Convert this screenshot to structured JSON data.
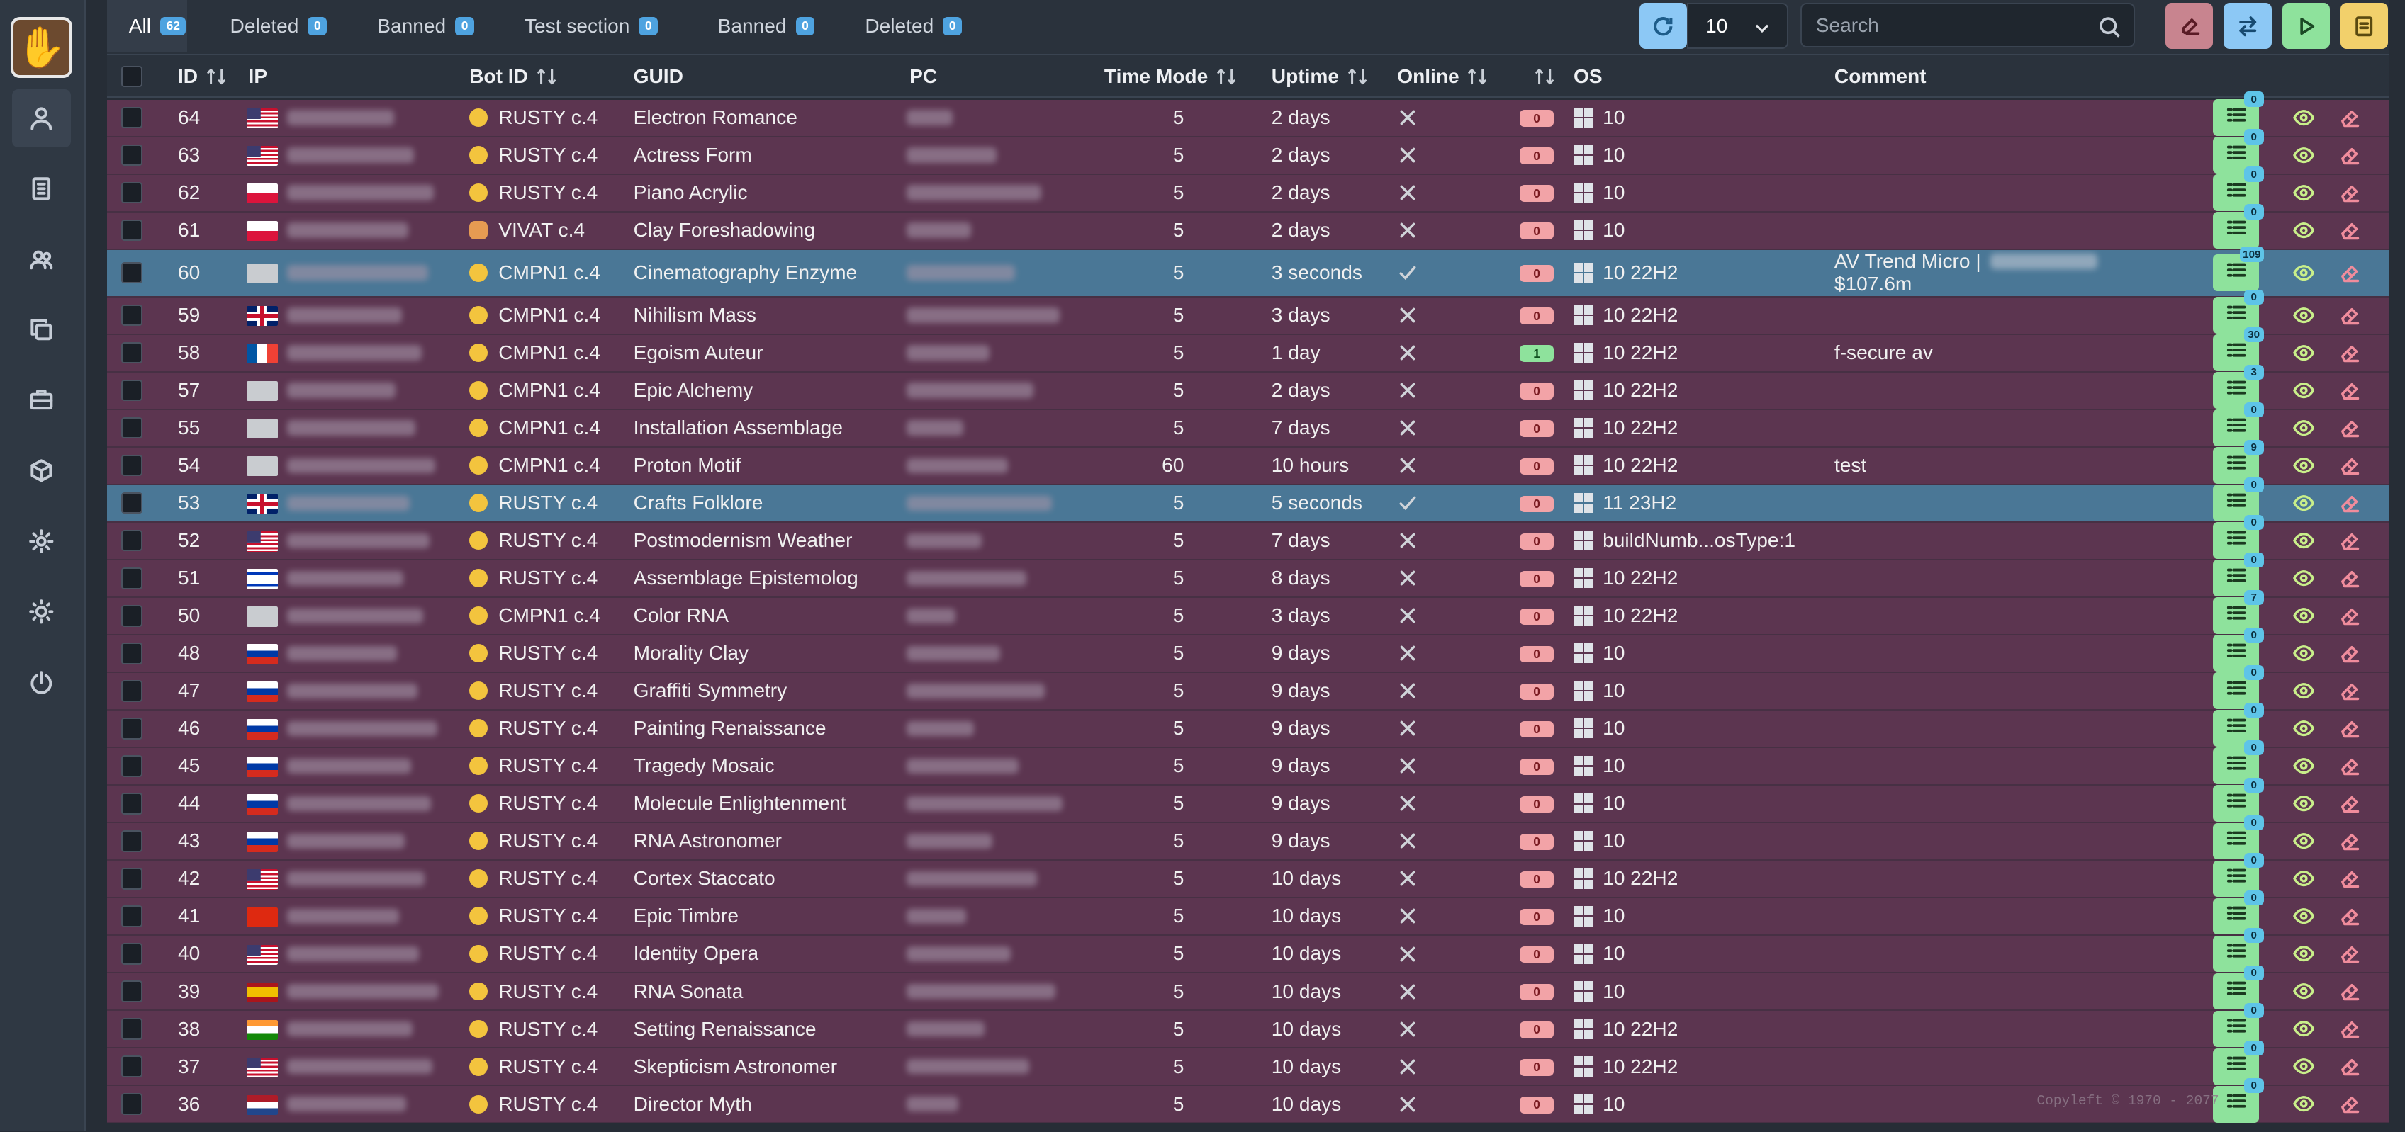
{
  "tabs": [
    {
      "label": "All",
      "count": "62"
    },
    {
      "label": "Deleted",
      "count": "0"
    },
    {
      "label": "Banned",
      "count": "0"
    },
    {
      "label": "Test section",
      "count": "0"
    },
    {
      "label": "Banned",
      "count": "0"
    },
    {
      "label": "Deleted",
      "count": "0"
    }
  ],
  "toolbar": {
    "page_size": "10",
    "search_placeholder": "Search"
  },
  "sidebar": {
    "icons": [
      "hand-logo",
      "user-icon",
      "document-icon",
      "users-icon",
      "copy-icon",
      "briefcase-icon",
      "cube-icon",
      "gear-icon",
      "sun-icon",
      "power-icon"
    ]
  },
  "columns": {
    "id": "ID",
    "ip": "IP",
    "bot_id": "Bot ID",
    "guid": "GUID",
    "pc": "PC",
    "time_mode": "Time Mode",
    "uptime": "Uptime",
    "online": "Online",
    "os": "OS",
    "comment": "Comment"
  },
  "colors": {
    "row": "#5c3550",
    "row_online": "#4a7796",
    "accent": "#4ea3e0",
    "success": "#8ee29c",
    "danger": "#f2a3a7"
  },
  "rows": [
    {
      "id": "64",
      "flag": "us",
      "bot": "RUSTY c.4",
      "guid": "Electron Romance",
      "tm": "5",
      "uptime": "2 days",
      "online": false,
      "cnt": "0",
      "os": "10",
      "comment": "",
      "notes": "0"
    },
    {
      "id": "63",
      "flag": "us",
      "bot": "RUSTY c.4",
      "guid": "Actress Form",
      "tm": "5",
      "uptime": "2 days",
      "online": false,
      "cnt": "0",
      "os": "10",
      "comment": "",
      "notes": "0"
    },
    {
      "id": "62",
      "flag": "pl",
      "bot": "RUSTY c.4",
      "guid": "Piano Acrylic",
      "tm": "5",
      "uptime": "2 days",
      "online": false,
      "cnt": "0",
      "os": "10",
      "comment": "",
      "notes": "0"
    },
    {
      "id": "61",
      "flag": "pl",
      "bot": "VIVAT c.4",
      "guid": "Clay Foreshadowing",
      "tm": "5",
      "uptime": "2 days",
      "online": false,
      "cnt": "0",
      "os": "10",
      "comment": "",
      "notes": "0"
    },
    {
      "id": "60",
      "flag": "xx",
      "bot": "CMPN1 c.4",
      "guid": "Cinematography Enzyme",
      "tm": "5",
      "uptime": "3 seconds",
      "online": true,
      "cnt": "0",
      "os": "10 22H2",
      "comment": "AV Trend Micro |",
      "comment2": "$107.6m",
      "notes": "109"
    },
    {
      "id": "59",
      "flag": "gb",
      "bot": "CMPN1 c.4",
      "guid": "Nihilism Mass",
      "tm": "5",
      "uptime": "3 days",
      "online": false,
      "cnt": "0",
      "os": "10 22H2",
      "comment": "",
      "notes": "0"
    },
    {
      "id": "58",
      "flag": "fr",
      "bot": "CMPN1 c.4",
      "guid": "Egoism Auteur",
      "tm": "5",
      "uptime": "1 day",
      "online": false,
      "cnt": "1",
      "os": "10 22H2",
      "comment": "f-secure av",
      "notes": "30"
    },
    {
      "id": "57",
      "flag": "xx",
      "bot": "CMPN1 c.4",
      "guid": "Epic Alchemy",
      "tm": "5",
      "uptime": "2 days",
      "online": false,
      "cnt": "0",
      "os": "10 22H2",
      "comment": "",
      "notes": "3"
    },
    {
      "id": "55",
      "flag": "xx",
      "bot": "CMPN1 c.4",
      "guid": "Installation Assemblage",
      "tm": "5",
      "uptime": "7 days",
      "online": false,
      "cnt": "0",
      "os": "10 22H2",
      "comment": "",
      "notes": "0"
    },
    {
      "id": "54",
      "flag": "xx",
      "bot": "CMPN1 c.4",
      "guid": "Proton Motif",
      "tm": "60",
      "uptime": "10 hours",
      "online": false,
      "cnt": "0",
      "os": "10 22H2",
      "comment": "test",
      "notes": "9"
    },
    {
      "id": "53",
      "flag": "gb",
      "bot": "RUSTY c.4",
      "guid": "Crafts Folklore",
      "tm": "5",
      "uptime": "5 seconds",
      "online": true,
      "cnt": "0",
      "os": "11 23H2",
      "comment": "",
      "notes": "0"
    },
    {
      "id": "52",
      "flag": "us",
      "bot": "RUSTY c.4",
      "guid": "Postmodernism Weather",
      "tm": "5",
      "uptime": "7 days",
      "online": false,
      "cnt": "0",
      "os": "buildNumb...osType:1",
      "comment": "",
      "notes": "0"
    },
    {
      "id": "51",
      "flag": "il",
      "bot": "RUSTY c.4",
      "guid": "Assemblage Epistemolog",
      "tm": "5",
      "uptime": "8 days",
      "online": false,
      "cnt": "0",
      "os": "10 22H2",
      "comment": "",
      "notes": "0"
    },
    {
      "id": "50",
      "flag": "xx",
      "bot": "CMPN1 c.4",
      "guid": "Color RNA",
      "tm": "5",
      "uptime": "3 days",
      "online": false,
      "cnt": "0",
      "os": "10 22H2",
      "comment": "",
      "notes": "7"
    },
    {
      "id": "48",
      "flag": "ru",
      "bot": "RUSTY c.4",
      "guid": "Morality Clay",
      "tm": "5",
      "uptime": "9 days",
      "online": false,
      "cnt": "0",
      "os": "10",
      "comment": "",
      "notes": "0"
    },
    {
      "id": "47",
      "flag": "ru",
      "bot": "RUSTY c.4",
      "guid": "Graffiti Symmetry",
      "tm": "5",
      "uptime": "9 days",
      "online": false,
      "cnt": "0",
      "os": "10",
      "comment": "",
      "notes": "0"
    },
    {
      "id": "46",
      "flag": "ru",
      "bot": "RUSTY c.4",
      "guid": "Painting Renaissance",
      "tm": "5",
      "uptime": "9 days",
      "online": false,
      "cnt": "0",
      "os": "10",
      "comment": "",
      "notes": "0"
    },
    {
      "id": "45",
      "flag": "ru",
      "bot": "RUSTY c.4",
      "guid": "Tragedy Mosaic",
      "tm": "5",
      "uptime": "9 days",
      "online": false,
      "cnt": "0",
      "os": "10",
      "comment": "",
      "notes": "0"
    },
    {
      "id": "44",
      "flag": "ru",
      "bot": "RUSTY c.4",
      "guid": "Molecule Enlightenment",
      "tm": "5",
      "uptime": "9 days",
      "online": false,
      "cnt": "0",
      "os": "10",
      "comment": "",
      "notes": "0"
    },
    {
      "id": "43",
      "flag": "ru",
      "bot": "RUSTY c.4",
      "guid": "RNA Astronomer",
      "tm": "5",
      "uptime": "9 days",
      "online": false,
      "cnt": "0",
      "os": "10",
      "comment": "",
      "notes": "0"
    },
    {
      "id": "42",
      "flag": "us",
      "bot": "RUSTY c.4",
      "guid": "Cortex Staccato",
      "tm": "5",
      "uptime": "10 days",
      "online": false,
      "cnt": "0",
      "os": "10 22H2",
      "comment": "",
      "notes": "0"
    },
    {
      "id": "41",
      "flag": "cn",
      "bot": "RUSTY c.4",
      "guid": "Epic Timbre",
      "tm": "5",
      "uptime": "10 days",
      "online": false,
      "cnt": "0",
      "os": "10",
      "comment": "",
      "notes": "0"
    },
    {
      "id": "40",
      "flag": "us",
      "bot": "RUSTY c.4",
      "guid": "Identity Opera",
      "tm": "5",
      "uptime": "10 days",
      "online": false,
      "cnt": "0",
      "os": "10",
      "comment": "",
      "notes": "0"
    },
    {
      "id": "39",
      "flag": "es",
      "bot": "RUSTY c.4",
      "guid": "RNA Sonata",
      "tm": "5",
      "uptime": "10 days",
      "online": false,
      "cnt": "0",
      "os": "10",
      "comment": "",
      "notes": "0"
    },
    {
      "id": "38",
      "flag": "in",
      "bot": "RUSTY c.4",
      "guid": "Setting Renaissance",
      "tm": "5",
      "uptime": "10 days",
      "online": false,
      "cnt": "0",
      "os": "10 22H2",
      "comment": "",
      "notes": "0"
    },
    {
      "id": "37",
      "flag": "us",
      "bot": "RUSTY c.4",
      "guid": "Skepticism Astronomer",
      "tm": "5",
      "uptime": "10 days",
      "online": false,
      "cnt": "0",
      "os": "10 22H2",
      "comment": "",
      "notes": "0"
    },
    {
      "id": "36",
      "flag": "nl",
      "bot": "RUSTY c.4",
      "guid": "Director Myth",
      "tm": "5",
      "uptime": "10 days",
      "online": false,
      "cnt": "0",
      "os": "10",
      "comment": "",
      "notes": "0"
    }
  ],
  "footer": {
    "copyleft": "Copyleft © 1970 - 2077"
  }
}
